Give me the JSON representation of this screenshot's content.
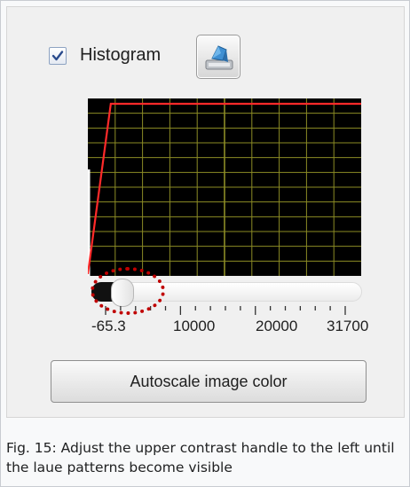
{
  "histogram": {
    "label": "Histogram",
    "checked": true,
    "checkbox_icon": "checkmark-icon",
    "action_icon": "blue-gem-pen-icon"
  },
  "chart_data": {
    "type": "line",
    "title": "",
    "xlabel": "",
    "ylabel": "",
    "grid": true,
    "colors": {
      "background": "#000000",
      "grid": "#8b8b25",
      "line": "#ff2a2a"
    },
    "series": [
      {
        "x": [
          -65.3,
          2600,
          31700
        ],
        "y": [
          0.0,
          1.0,
          1.0
        ]
      }
    ],
    "tick_labels": [
      "-65.3",
      "10000",
      "20000",
      "31700"
    ],
    "xlim": [
      -65.3,
      31700
    ]
  },
  "slider": {
    "min_label": "-65.3",
    "max_label": "31700",
    "upper_handle_fraction": 0.09,
    "highlight_color": "#c00000"
  },
  "button": {
    "label": "Autoscale image color"
  },
  "caption": "Fig. 15: Adjust the upper contrast handle to the left until the laue patterns become visible"
}
